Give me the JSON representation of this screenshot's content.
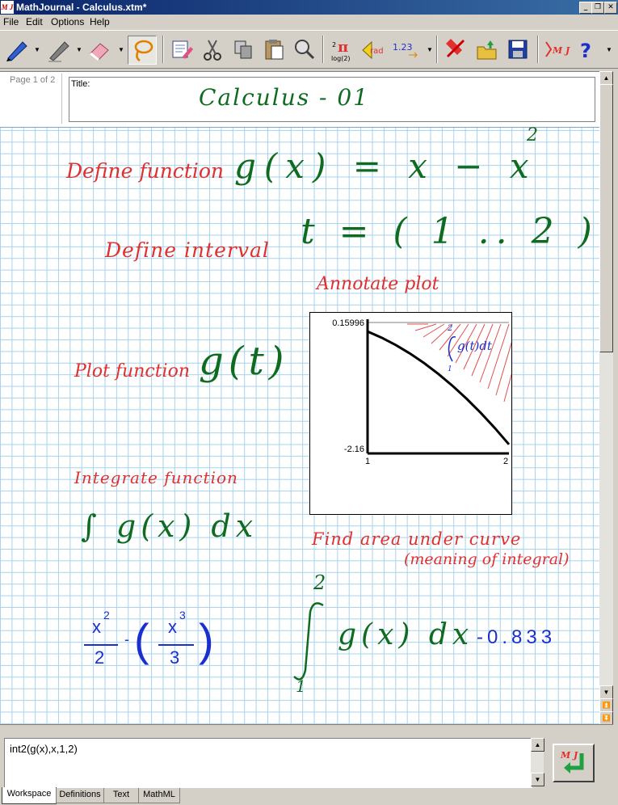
{
  "window": {
    "title": "MathJournal - Calculus.xtm*",
    "icon": "M J"
  },
  "menu": [
    "File",
    "Edit",
    "Options",
    "Help"
  ],
  "toolbar": {
    "sign_text": "1.23",
    "icon_sub": "log(2)",
    "icon_rad": "rad",
    "icon_mj": "M J",
    "help": "?"
  },
  "page": {
    "indicator": "Page 1 of 2",
    "title_label": "Title:",
    "title_text": "Calculus - 01"
  },
  "notes": {
    "define_function": "Define function",
    "define_interval": "Define interval",
    "plot_function": "Plot function",
    "annotate_plot": "Annotate plot",
    "integrate_function": "Integrate function",
    "find_area": "Find area under curve",
    "meaning": "(meaning of integral)"
  },
  "math": {
    "gx_def": "g(x) = x − x",
    "exp2": "2",
    "interval": "t = ( 1 .. 2 )",
    "plot_call": "g(t)",
    "integral_expr": "∫ g(x) dx",
    "result_num_a": "x",
    "result_exp_a": "2",
    "result_den_a": "2",
    "result_minus": "-",
    "result_num_b": "x",
    "result_exp_b": "3",
    "result_den_b": "3",
    "def_upper": "2",
    "def_lower": "1",
    "def_body": "g(x) dx",
    "def_result": "-0.833",
    "plot_annotation": "g(t)dt",
    "plot_annotation_upper": "2",
    "plot_annotation_lower": "1"
  },
  "chart_data": {
    "type": "line",
    "x": [
      1.0,
      1.1,
      1.2,
      1.3,
      1.4,
      1.5,
      1.6,
      1.7,
      1.8,
      1.9,
      2.0
    ],
    "y": [
      0.0,
      -0.11,
      -0.24,
      -0.39,
      -0.56,
      -0.75,
      -0.96,
      -1.19,
      -1.44,
      -1.71,
      -2.0
    ],
    "xlim": [
      1,
      2
    ],
    "ylim": [
      -2.16,
      0.15996
    ],
    "x_tick_labels": [
      "1",
      "2"
    ],
    "y_tick_labels": [
      "0.15996",
      "-2.16"
    ],
    "title": "",
    "xlabel": "",
    "ylabel": "",
    "grid": false
  },
  "command": {
    "value": "int2(g(x),x,1,2)"
  },
  "tabs": [
    "Workspace",
    "Definitions",
    "Text",
    "MathML"
  ],
  "colors": {
    "green": "#0e6b1f",
    "red": "#e03030",
    "blue": "#1a2fd0",
    "gridline": "#a7d3ec"
  }
}
